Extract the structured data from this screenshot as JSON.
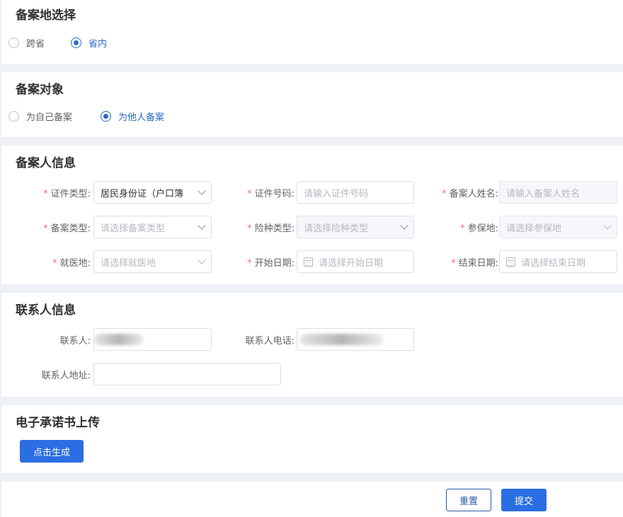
{
  "sections": {
    "location": {
      "title": "备案地选择",
      "options": [
        "跨省",
        "省内"
      ],
      "selected": "省内"
    },
    "target": {
      "title": "备案对象",
      "options": [
        "为自己备案",
        "为他人备案"
      ],
      "selected": "为他人备案"
    },
    "filer_info": {
      "title": "备案人信息",
      "id_type": {
        "label": "证件类型:",
        "value": "居民身份证（户口簿"
      },
      "id_number": {
        "label": "证件号码:",
        "placeholder": "请输入证件号码"
      },
      "filer_name": {
        "label": "备案人姓名:",
        "placeholder": "请输入备案人姓名"
      },
      "filing_type": {
        "label": "备案类型:",
        "placeholder": "请选择备案类型"
      },
      "insurance_type": {
        "label": "险种类型:",
        "placeholder": "请选择险种类型"
      },
      "insured_place": {
        "label": "参保地:",
        "placeholder": "请选择参保地"
      },
      "medical_place": {
        "label": "就医地:",
        "placeholder": "请选择就医地"
      },
      "start_date": {
        "label": "开始日期:",
        "placeholder": "请选择开始日期"
      },
      "end_date": {
        "label": "结束日期:",
        "placeholder": "请选择结束日期"
      }
    },
    "contact_info": {
      "title": "联系人信息",
      "contact_person": {
        "label": "联系人:"
      },
      "contact_phone": {
        "label": "联系人电话:"
      },
      "contact_address": {
        "label": "联系人地址:",
        "value": ""
      }
    },
    "upload": {
      "title": "电子承诺书上传",
      "generate_button": "点击生成"
    }
  },
  "footer": {
    "reset_button": "重置",
    "submit_button": "提交"
  },
  "colors": {
    "primary": "#2b6de3",
    "radio_checked": "#2a6bc7",
    "required": "#f56c6c",
    "page_bg": "#eef1f5"
  }
}
